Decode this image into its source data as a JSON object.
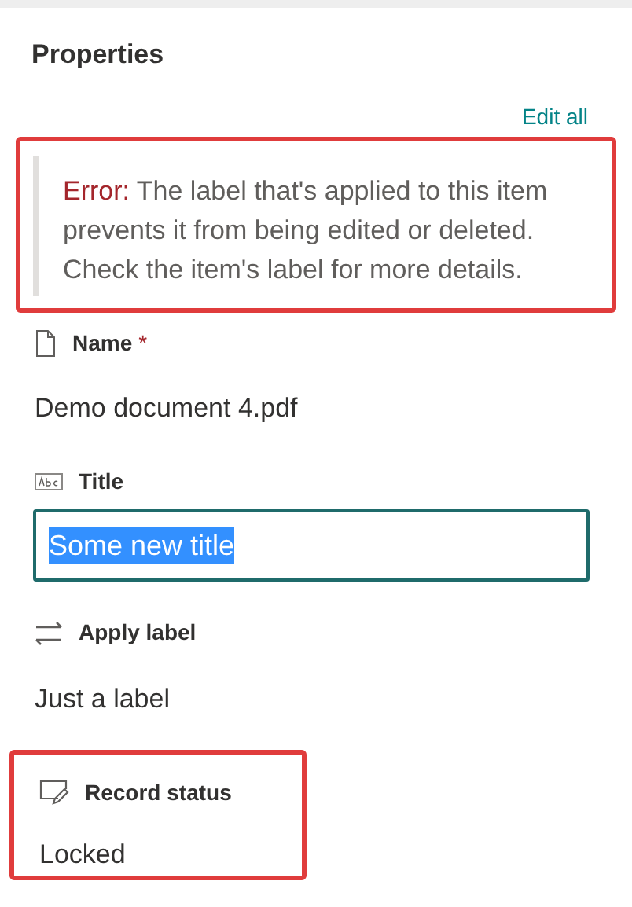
{
  "panel": {
    "title": "Properties",
    "edit_all_link": "Edit all"
  },
  "error_message": {
    "label": "Error:",
    "text": "The label that's applied to this item prevents it from being edited or deleted. Check the item's label for more details.",
    "highlighted": true
  },
  "fields": [
    {
      "kind": "name",
      "label": "Name",
      "required": true,
      "required_mark": "*",
      "value": "Demo document 4.pdf",
      "highlighted": false
    },
    {
      "kind": "text_input",
      "label": "Title",
      "required": false,
      "value": "Some new title",
      "text_selected": true,
      "highlighted": false
    },
    {
      "kind": "label",
      "label": "Apply label",
      "required": false,
      "value": "Just a label",
      "highlighted": false
    },
    {
      "kind": "status",
      "label": "Record status",
      "required": false,
      "value": "Locked",
      "highlighted": true
    }
  ]
}
